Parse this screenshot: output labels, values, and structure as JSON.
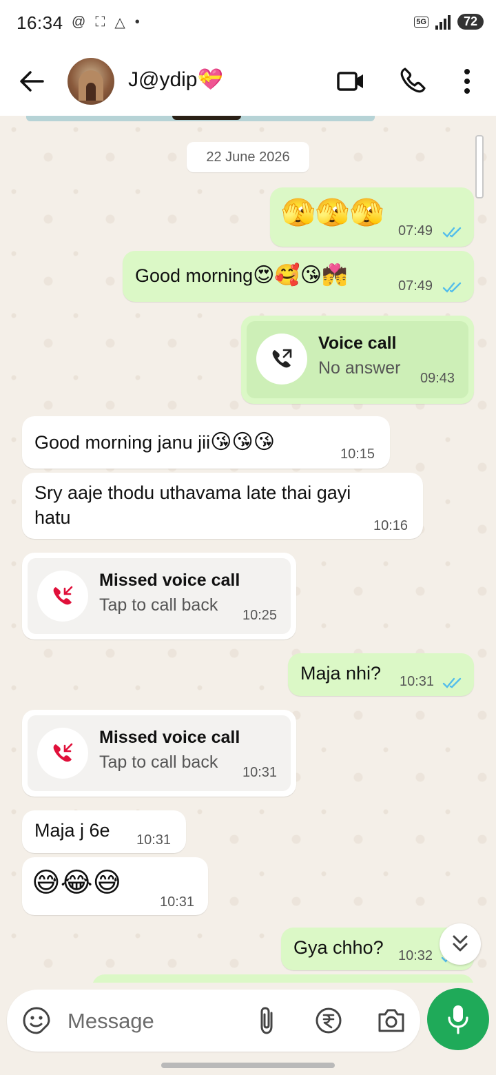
{
  "status_bar": {
    "time": "16:34",
    "network": "5G",
    "battery": "72"
  },
  "header": {
    "contact_name": "J@ydip💝"
  },
  "chat": {
    "date_chip": "22 June 2026",
    "messages": [
      {
        "id": "m1",
        "direction": "out",
        "emoji": "🫣🫣🫣",
        "time": "07:49",
        "status": "read"
      },
      {
        "id": "m2",
        "direction": "out",
        "text": "Good morning",
        "emoji": "😍🥰😘💏",
        "time": "07:49",
        "status": "read"
      },
      {
        "id": "m3",
        "direction": "out",
        "call_title": "Voice call",
        "call_subtitle": "No answer",
        "time": "09:43"
      },
      {
        "id": "m4",
        "direction": "in",
        "text": "Good morning janu jii",
        "emoji": "😘😘😘",
        "time": "10:15"
      },
      {
        "id": "m5",
        "direction": "in",
        "line1": "Sry aaje thodu uthavama late thai gayi",
        "line2": "hatu",
        "time": "10:16"
      },
      {
        "id": "m6",
        "direction": "in",
        "call_title": "Missed voice call",
        "call_subtitle": "Tap to call back",
        "time": "10:25"
      },
      {
        "id": "m7",
        "direction": "out",
        "text": "Maja nhi?",
        "time": "10:31",
        "status": "read"
      },
      {
        "id": "m8",
        "direction": "in",
        "call_title": "Missed voice call",
        "call_subtitle": "Tap to call back",
        "time": "10:31"
      },
      {
        "id": "m9",
        "direction": "in",
        "text": "Maja j 6e",
        "time": "10:31"
      },
      {
        "id": "m10",
        "direction": "in",
        "emoji": "😅😂😅",
        "time": "10:31"
      },
      {
        "id": "m11",
        "direction": "out",
        "text": "Gya chho?",
        "time": "10:32",
        "status": "read"
      }
    ]
  },
  "composer": {
    "placeholder": "Message"
  },
  "colors": {
    "outgoing_bubble": "#dbf8c6",
    "incoming_bubble": "#ffffff",
    "read_ticks": "#53bdeb",
    "mic_button": "#1faa59",
    "missed_call_icon": "#e0103a"
  }
}
